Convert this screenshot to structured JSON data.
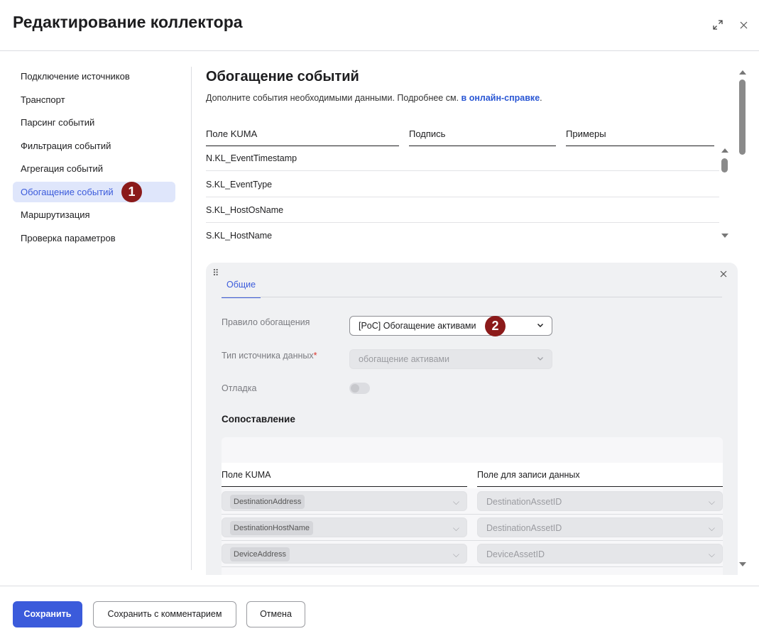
{
  "header": {
    "title": "Редактирование коллектора",
    "expand_icon": "expand-icon",
    "close_icon": "close-icon"
  },
  "sidebar": {
    "items": [
      {
        "label": "Подключение источников"
      },
      {
        "label": "Транспорт"
      },
      {
        "label": "Парсинг событий"
      },
      {
        "label": "Фильтрация событий"
      },
      {
        "label": "Агрегация событий"
      },
      {
        "label": "Обогащение событий",
        "active": true
      },
      {
        "label": "Маршрутизация"
      },
      {
        "label": "Проверка параметров"
      }
    ],
    "active_badge": "1"
  },
  "main": {
    "title": "Обогащение событий",
    "description": "Дополните события необходимыми данными. Подробнее см.",
    "help_link": "в онлайн-справке",
    "description_end": ".",
    "table": {
      "columns": [
        "Поле KUMA",
        "Подпись",
        "Примеры"
      ],
      "rows": [
        "N.KL_EventTimestamp",
        "S.KL_EventType",
        "S.KL_HostOsName",
        "S.KL_HostName"
      ]
    }
  },
  "rule_card": {
    "tab": "Общие",
    "fields": {
      "rule_label": "Правило обогащения",
      "rule_value": "[PoC] Обогащение активами",
      "rule_badge": "2",
      "source_type_label": "Тип источника данных",
      "required_mark": "*",
      "source_type_value": "обогащение активами",
      "debug_label": "Отладка",
      "debug_enabled": false
    },
    "mapping": {
      "title": "Сопоставление",
      "columns": [
        "Поле KUMA",
        "Поле для записи данных"
      ],
      "rows": [
        {
          "kuma_field": "DestinationAddress",
          "target_field": "DestinationAssetID"
        },
        {
          "kuma_field": "DestinationHostName",
          "target_field": "DestinationAssetID"
        },
        {
          "kuma_field": "DeviceAddress",
          "target_field": "DeviceAssetID"
        }
      ]
    }
  },
  "footer": {
    "save": "Сохранить",
    "save_with_comment": "Сохранить с комментарием",
    "cancel": "Отмена"
  },
  "colors": {
    "accent": "#3b5bdb",
    "badge": "#8b1a1a",
    "link": "#2a57d4"
  }
}
